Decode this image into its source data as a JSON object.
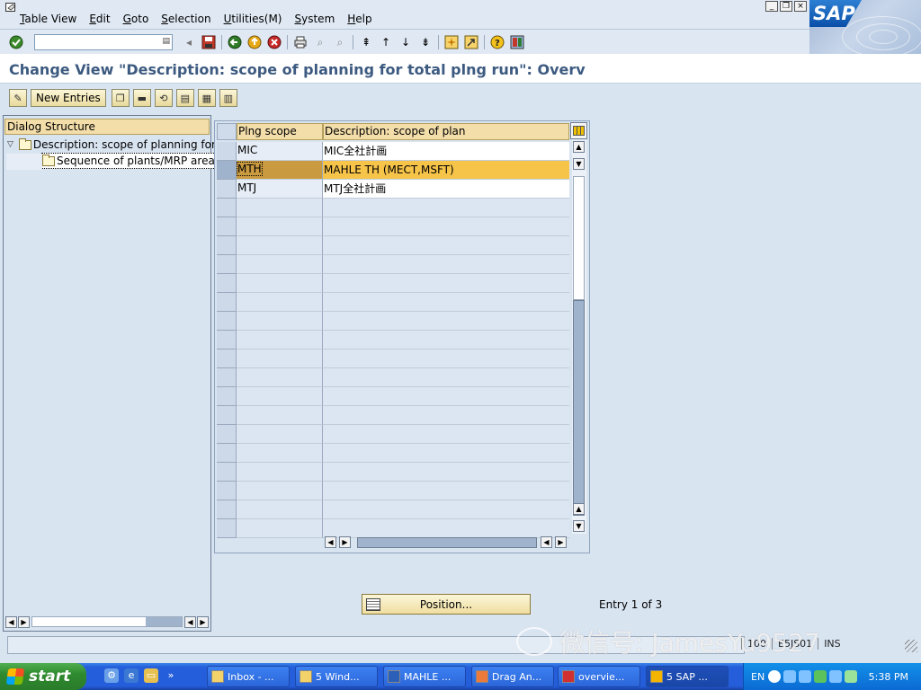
{
  "menu": {
    "items": [
      "Table View",
      "Edit",
      "Goto",
      "Selection",
      "Utilities(M)",
      "System",
      "Help"
    ]
  },
  "window_controls": {
    "minimize": "_",
    "restore": "❐",
    "close": "×"
  },
  "logo": {
    "text": "SAP"
  },
  "standard_toolbar": {
    "command_field": "",
    "icons": [
      "enter-icon",
      "back-arrow-icon",
      "save-icon",
      "back-icon",
      "exit-icon",
      "cancel-icon",
      "print-icon",
      "find-icon",
      "find-next-icon",
      "first-page-icon",
      "previous-page-icon",
      "next-page-icon",
      "last-page-icon",
      "create-session-icon",
      "shortcut-icon",
      "help-icon",
      "customize-layout-icon"
    ]
  },
  "title": "Change View \"Description: scope of planning for total plng run\": Overv",
  "app_toolbar": {
    "new_entries_label": "New Entries"
  },
  "dialog_structure": {
    "header": "Dialog Structure",
    "tree": [
      {
        "label": "Description: scope of planning for",
        "level": 0,
        "expanded": true
      },
      {
        "label": "Sequence of plants/MRP areas",
        "level": 1,
        "selected": true
      }
    ]
  },
  "table": {
    "columns": [
      "Plng scope",
      "Description: scope of plan"
    ],
    "rows": [
      {
        "scope": "MIC",
        "description": "MIC全社計画"
      },
      {
        "scope": "MTH",
        "description": "MAHLE TH (MECT,MSFT)"
      },
      {
        "scope": "MTJ",
        "description": "MTJ全社計画"
      }
    ],
    "highlighted_row": 1,
    "visible_row_count": 21
  },
  "position_button": {
    "label": "Position..."
  },
  "entry_info": "Entry 1 of 3",
  "status_bar": {
    "client": "100",
    "server": "E5JS01",
    "mode": "INS"
  },
  "watermark": "微信号: JamesYu9527",
  "taskbar": {
    "start_label": "start",
    "tasks": [
      {
        "label": "Inbox - ...",
        "icon": "outlook-icon"
      },
      {
        "label": "5 Wind...",
        "icon": "folder-icon"
      },
      {
        "label": "MAHLE ...",
        "icon": "word-icon"
      },
      {
        "label": "Drag An...",
        "icon": "paint-icon"
      },
      {
        "label": "overvie...",
        "icon": "pdf-icon"
      },
      {
        "label": "5 SAP ...",
        "icon": "sap-icon"
      }
    ],
    "language": "EN",
    "clock": "5:38 PM"
  }
}
